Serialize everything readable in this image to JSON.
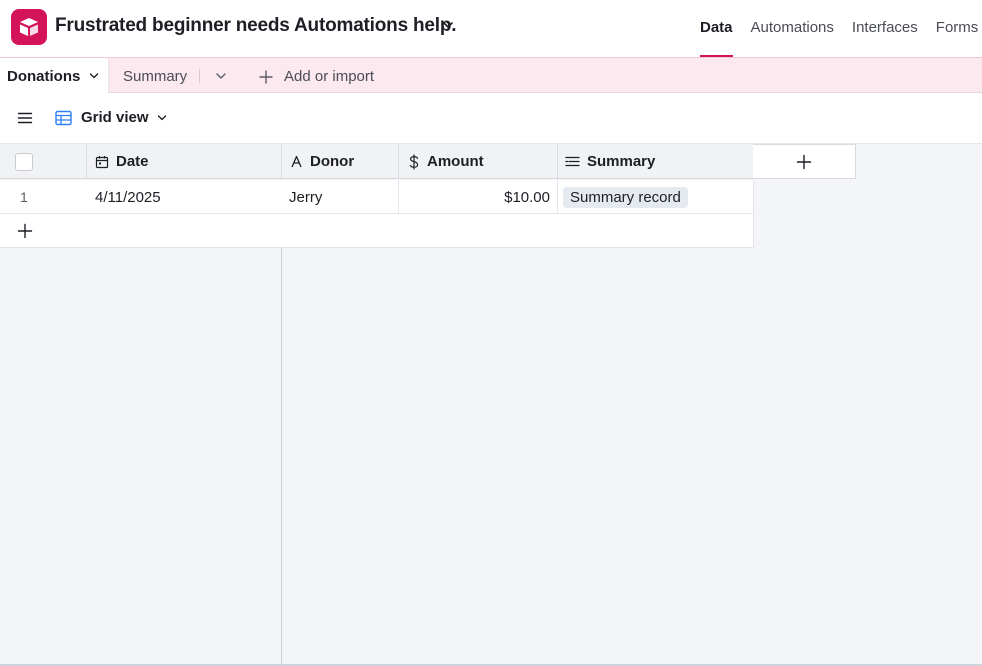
{
  "header": {
    "base_title": "Frustrated beginner needs Automations help.",
    "nav": [
      {
        "label": "Data",
        "active": true
      },
      {
        "label": "Automations",
        "active": false
      },
      {
        "label": "Interfaces",
        "active": false
      },
      {
        "label": "Forms",
        "active": false
      }
    ],
    "accent_color": "#d4145a"
  },
  "tabs": {
    "active": "Donations",
    "other": "Summary",
    "add_import": "Add or import"
  },
  "view": {
    "name": "Grid view",
    "icon": "grid-view-icon"
  },
  "grid": {
    "columns": [
      {
        "label": "Date",
        "icon": "calendar-icon"
      },
      {
        "label": "Donor",
        "icon": "text-field-icon"
      },
      {
        "label": "Amount",
        "icon": "currency-icon"
      },
      {
        "label": "Summary",
        "icon": "linked-record-icon"
      }
    ],
    "rows": [
      {
        "num": "1",
        "date": "4/11/2025",
        "donor": "Jerry",
        "amount": "$10.00",
        "summary": "Summary record"
      }
    ]
  }
}
